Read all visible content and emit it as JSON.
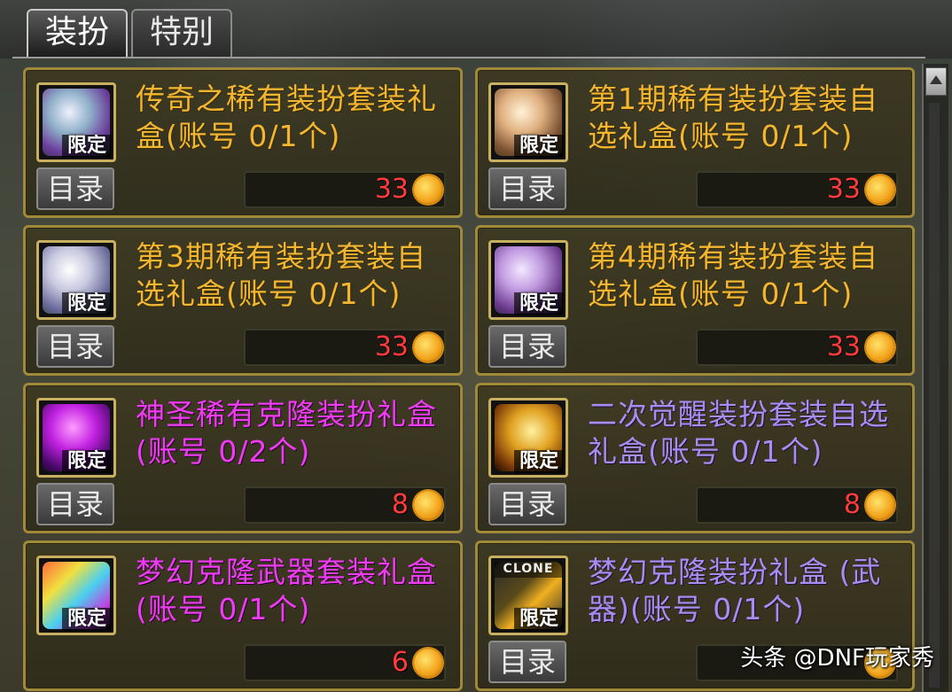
{
  "tabs": [
    {
      "label": "装扮",
      "active": true
    },
    {
      "label": "特别",
      "active": false
    }
  ],
  "common": {
    "catalog_label": "目录",
    "limit_badge": "限定"
  },
  "items": [
    {
      "title": "传奇之稀有装扮套装礼盒(账号 0/1个)",
      "price": "33",
      "color": "gold",
      "icon": "legendary-avatar-box-icon"
    },
    {
      "title": "第1期稀有装扮套装自选礼盒(账号 0/1个)",
      "price": "33",
      "color": "gold",
      "icon": "season1-avatar-box-icon"
    },
    {
      "title": "第3期稀有装扮套装自选礼盒(账号 0/1个)",
      "price": "33",
      "color": "gold",
      "icon": "season3-avatar-box-icon"
    },
    {
      "title": "第4期稀有装扮套装自选礼盒(账号 0/1个)",
      "price": "33",
      "color": "gold",
      "icon": "season4-avatar-box-icon"
    },
    {
      "title": "神圣稀有克隆装扮礼盒(账号 0/2个)",
      "price": "8",
      "color": "magenta",
      "icon": "holy-clone-box-icon"
    },
    {
      "title": "二次觉醒装扮套装自选礼盒(账号 0/1个)",
      "price": "8",
      "color": "violet",
      "icon": "second-awakening-box-icon"
    },
    {
      "title": "梦幻克隆武器套装礼盒(账号 0/1个)",
      "price": "6",
      "color": "magenta",
      "icon": "dream-clone-weapon-box-icon"
    },
    {
      "title": "梦幻克隆装扮礼盒 (武器)(账号 0/1个)",
      "price": "",
      "color": "violet",
      "icon": "dream-clone-avatar-box-icon",
      "icon_text": "CLONE"
    }
  ],
  "watermark": "头条 @DNF玩家秀",
  "colors": {
    "gold": "#f2b632",
    "magenta": "#ee3cf2",
    "violet": "#a98cf0",
    "price": "#ff3b3b",
    "border": "#a08a3a"
  }
}
